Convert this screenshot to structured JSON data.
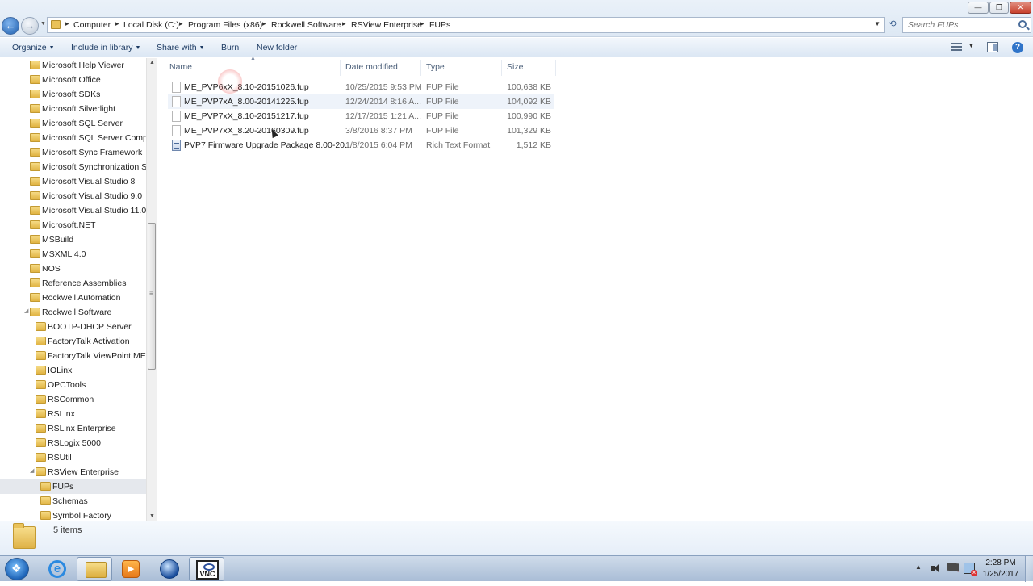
{
  "window": {
    "controls": {
      "minimize": "—",
      "maximize": "❐",
      "close": "✕"
    }
  },
  "address_bar": {
    "crumbs": [
      "Computer",
      "Local Disk (C:)",
      "Program Files (x86)",
      "Rockwell Software",
      "RSView Enterprise",
      "FUPs"
    ],
    "search_placeholder": "Search FUPs"
  },
  "toolbar": {
    "organize": "Organize",
    "include_in_library": "Include in library",
    "share_with": "Share with",
    "burn": "Burn",
    "new_folder": "New folder",
    "help": "?"
  },
  "nav_pane": {
    "items": [
      {
        "label": "Microsoft Help Viewer",
        "level": 0,
        "selected": false
      },
      {
        "label": "Microsoft Office",
        "level": 0,
        "selected": false
      },
      {
        "label": "Microsoft SDKs",
        "level": 0,
        "selected": false
      },
      {
        "label": "Microsoft Silverlight",
        "level": 0,
        "selected": false
      },
      {
        "label": "Microsoft SQL Server",
        "level": 0,
        "selected": false
      },
      {
        "label": "Microsoft SQL Server Compa",
        "level": 0,
        "selected": false
      },
      {
        "label": "Microsoft Sync Framework",
        "level": 0,
        "selected": false
      },
      {
        "label": "Microsoft Synchronization Se",
        "level": 0,
        "selected": false
      },
      {
        "label": "Microsoft Visual Studio 8",
        "level": 0,
        "selected": false
      },
      {
        "label": "Microsoft Visual Studio 9.0",
        "level": 0,
        "selected": false
      },
      {
        "label": "Microsoft Visual Studio 11.0",
        "level": 0,
        "selected": false
      },
      {
        "label": "Microsoft.NET",
        "level": 0,
        "selected": false
      },
      {
        "label": "MSBuild",
        "level": 0,
        "selected": false
      },
      {
        "label": "MSXML 4.0",
        "level": 0,
        "selected": false
      },
      {
        "label": "NOS",
        "level": 0,
        "selected": false
      },
      {
        "label": "Reference Assemblies",
        "level": 0,
        "selected": false
      },
      {
        "label": "Rockwell Automation",
        "level": 0,
        "selected": false
      },
      {
        "label": "Rockwell Software",
        "level": 0,
        "selected": false,
        "expanded": true
      },
      {
        "label": "BOOTP-DHCP Server",
        "level": 1,
        "selected": false
      },
      {
        "label": "FactoryTalk Activation",
        "level": 1,
        "selected": false
      },
      {
        "label": "FactoryTalk ViewPoint ME",
        "level": 1,
        "selected": false
      },
      {
        "label": "IOLinx",
        "level": 1,
        "selected": false
      },
      {
        "label": "OPCTools",
        "level": 1,
        "selected": false
      },
      {
        "label": "RSCommon",
        "level": 1,
        "selected": false
      },
      {
        "label": "RSLinx",
        "level": 1,
        "selected": false
      },
      {
        "label": "RSLinx Enterprise",
        "level": 1,
        "selected": false
      },
      {
        "label": "RSLogix 5000",
        "level": 1,
        "selected": false
      },
      {
        "label": "RSUtil",
        "level": 1,
        "selected": false
      },
      {
        "label": "RSView Enterprise",
        "level": 1,
        "selected": false,
        "expanded": true
      },
      {
        "label": "FUPs",
        "level": 2,
        "selected": true
      },
      {
        "label": "Schemas",
        "level": 2,
        "selected": false
      },
      {
        "label": "Symbol Factory",
        "level": 2,
        "selected": false
      }
    ]
  },
  "file_list": {
    "columns": {
      "name": "Name",
      "date_modified": "Date modified",
      "type": "Type",
      "size": "Size"
    },
    "rows": [
      {
        "name": "ME_PVP6xX_8.10-20151026.fup",
        "date": "10/25/2015 9:53 PM",
        "type": "FUP File",
        "size": "100,638 KB",
        "icon": "file-icon"
      },
      {
        "name": "ME_PVP7xA_8.00-20141225.fup",
        "date": "12/24/2014 8:16 A...",
        "type": "FUP File",
        "size": "104,092 KB",
        "icon": "file-icon"
      },
      {
        "name": "ME_PVP7xX_8.10-20151217.fup",
        "date": "12/17/2015 1:21 A...",
        "type": "FUP File",
        "size": "100,990 KB",
        "icon": "file-icon"
      },
      {
        "name": "ME_PVP7xX_8.20-20160309.fup",
        "date": "3/8/2016 8:37 PM",
        "type": "FUP File",
        "size": "101,329 KB",
        "icon": "file-icon"
      },
      {
        "name": "PVP7 Firmware Upgrade Package 8.00-20...",
        "date": "1/8/2015 6:04 PM",
        "type": "Rich Text Format",
        "size": "1,512 KB",
        "icon": "rtf-document-icon"
      }
    ]
  },
  "details_pane": {
    "item_count": "5 items"
  },
  "taskbar": {
    "apps": [
      "start-orb",
      "internet-explorer-icon",
      "windows-explorer-icon",
      "media-player-icon",
      "blue-globe-app-icon",
      "vnc-icon"
    ],
    "vnc_text": "VNC",
    "ie_text": "e",
    "clock_time": "2:28 PM",
    "clock_date": "1/25/2017"
  }
}
